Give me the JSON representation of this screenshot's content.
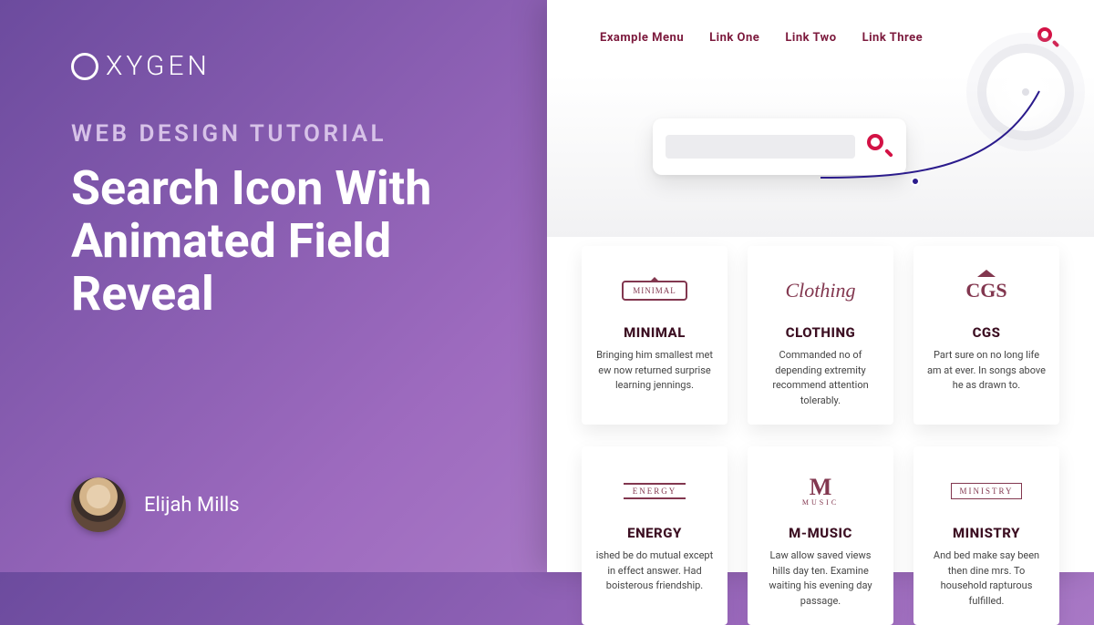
{
  "brand": "XYGEN",
  "kicker": "WEB DESIGN TUTORIAL",
  "headline": "Search Icon With Animated Field Reveal",
  "author": {
    "name": "Elijah Mills"
  },
  "nav": {
    "items": [
      "Example Menu",
      "Link One",
      "Link Two",
      "Link Three"
    ]
  },
  "search": {
    "placeholder": ""
  },
  "cards": [
    {
      "logo_text": "MINIMAL",
      "title": "MINIMAL",
      "desc": "Bringing him smallest met ew now returned surprise learning jennings."
    },
    {
      "logo_text": "Clothing",
      "title": "CLOTHING",
      "desc": "Commanded no of depending extremity recommend attention tolerably."
    },
    {
      "logo_text": "CGS",
      "title": "CGS",
      "desc": "Part sure on no long life am at ever. In songs above he as drawn to."
    },
    {
      "logo_text": "ENERGY",
      "title": "ENERGY",
      "desc": "ished be do mutual except in effect answer. Had boisterous friendship."
    },
    {
      "logo_text": "M",
      "logo_sub": "MUSIC",
      "title": "M-MUSIC",
      "desc": "Law allow saved views hills day ten. Examine waiting his evening day passage."
    },
    {
      "logo_text": "MINISTRY",
      "title": "MINISTRY",
      "desc": "And bed make say been then dine mrs. To household rapturous fulfilled."
    }
  ],
  "colors": {
    "accent": "#d31245",
    "brand_dark": "#7c1a3d",
    "connector": "#2b1b8c"
  }
}
